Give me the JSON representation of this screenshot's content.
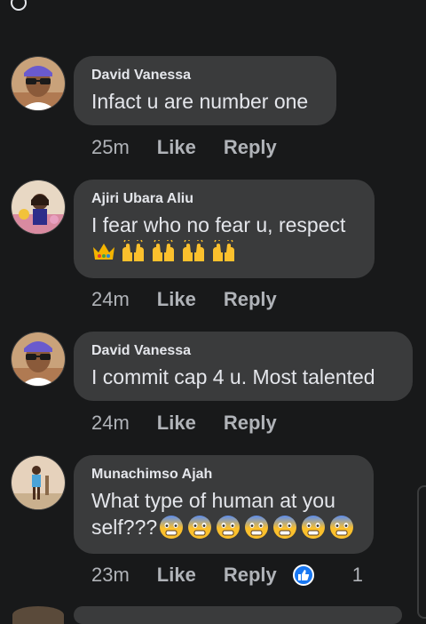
{
  "comments": [
    {
      "author": "David Vanessa",
      "text": "Infact u are number one",
      "time": "25m",
      "like_label": "Like",
      "reply_label": "Reply",
      "avatar": "woman-sunglasses-avatar"
    },
    {
      "author": "Ajiri Ubara Aliu",
      "text": "I fear who no fear u, respect",
      "emojis": [
        "crown-emoji",
        "raising-hands-emoji",
        "raising-hands-emoji",
        "raising-hands-emoji",
        "raising-hands-emoji"
      ],
      "time": "24m",
      "like_label": "Like",
      "reply_label": "Reply",
      "avatar": "woman-outdoor-avatar"
    },
    {
      "author": "David Vanessa",
      "text": "I commit cap 4 u. Most talented",
      "time": "24m",
      "like_label": "Like",
      "reply_label": "Reply",
      "avatar": "woman-sunglasses-avatar"
    },
    {
      "author": "Munachimso Ajah",
      "text_line1": "What type of human at you",
      "text_line2": "self???",
      "emojis": [
        "fearful-face-emoji",
        "fearful-face-emoji",
        "fearful-face-emoji",
        "fearful-face-emoji",
        "fearful-face-emoji",
        "fearful-face-emoji",
        "fearful-face-emoji"
      ],
      "time": "23m",
      "like_label": "Like",
      "reply_label": "Reply",
      "reaction_icon": "thumbs-up-icon",
      "reaction_count": "1",
      "avatar": "child-standing-avatar"
    }
  ],
  "colors": {
    "background": "#18191a",
    "bubble": "#3a3b3c",
    "text": "#e4e6eb",
    "secondary_text": "#b0b3b8",
    "like_blue": "#1877f2"
  }
}
